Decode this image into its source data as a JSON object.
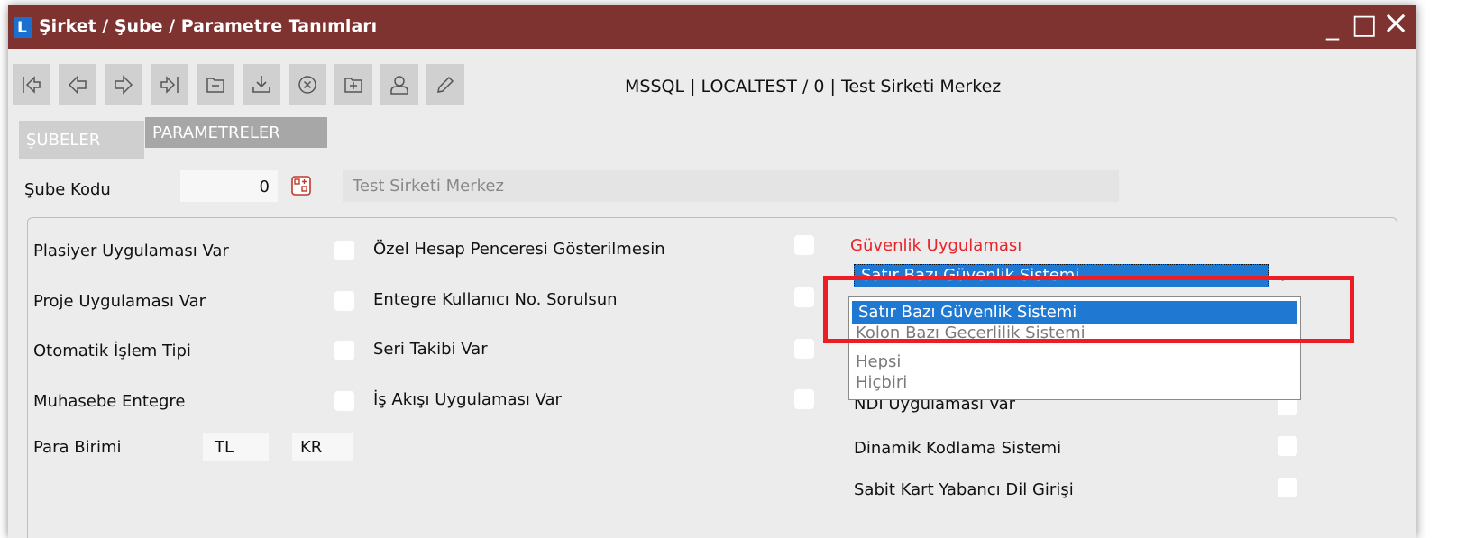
{
  "window": {
    "title": "Şirket / Şube / Parametre Tanımları",
    "app_icon": "L",
    "minimize_glyph": "_",
    "maximize_glyph": "□",
    "close_glyph": "×"
  },
  "toolbar": {
    "buttons": [
      {
        "icon": "first-record-icon"
      },
      {
        "icon": "previous-record-icon"
      },
      {
        "icon": "next-record-icon"
      },
      {
        "icon": "last-record-icon"
      },
      {
        "icon": "minus-folder-icon"
      },
      {
        "icon": "download-icon"
      },
      {
        "icon": "cancel-icon"
      },
      {
        "icon": "add-folder-icon"
      },
      {
        "icon": "user-icon"
      },
      {
        "icon": "pencil-icon"
      }
    ],
    "connection": "MSSQL | LOCALTEST / 0 | Test Sirketi Merkez"
  },
  "tabs": [
    "ŞUBELER",
    "PARAMETRELER"
  ],
  "sube": {
    "label": "Şube Kodu",
    "code": "0",
    "name": "Test Sirketi Merkez"
  },
  "col1": {
    "plasiyer": "Plasiyer Uygulaması Var",
    "proje": "Proje Uygulaması Var",
    "otomatik": "Otomatik İşlem Tipi",
    "muhasebe": "Muhasebe Entegre",
    "para_label": "Para Birimi",
    "para_1": "TL",
    "para_2": "KR"
  },
  "col2": {
    "ozel": "Özel Hesap Penceresi Gösterilmesin",
    "entegre": "Entegre Kullanıcı No. Sorulsun",
    "seri": "Seri Takibi Var",
    "is_akisi": "İş Akışı Uygulaması Var"
  },
  "col3": {
    "guvenlik_label": "Güvenlik Uygulaması",
    "guvenlik_value": "Satır Bazı Güvenlik Sistemi",
    "ndi": "NDI Uygulaması Var",
    "dinamik": "Dinamik Kodlama Sistemi",
    "sabit": "Sabit Kart Yabancı Dil Girişi"
  },
  "dropdown": {
    "options": [
      "Satır Bazı Güvenlik Sistemi",
      "Kolon Bazı Geçerlilik Sistemi",
      "Hepsi",
      "Hiçbiri"
    ],
    "selected": "Satır Bazı Güvenlik Sistemi"
  },
  "colors": {
    "titlebar": "#7f3330",
    "selection": "#1f78d1",
    "highlight": "#ee1c24",
    "label_red": "#e8242a"
  }
}
